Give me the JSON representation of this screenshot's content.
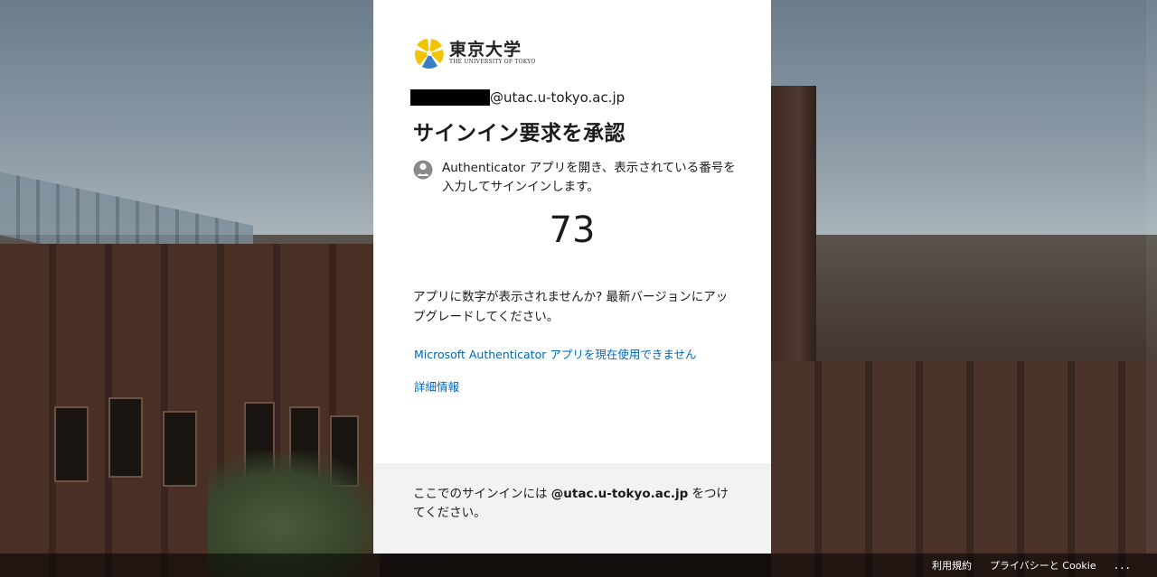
{
  "page": {
    "brand": {
      "name_jp": "東京大学",
      "name_en": "THE UNIVERSITY OF TOKYO",
      "icon": "ginkgo-leaf-icon",
      "colors": {
        "yellow": "#f2c400",
        "blue": "#3a7ec8"
      }
    },
    "account": {
      "email_suffix": "@utac.u-tokyo.ac.jp"
    },
    "title": "サインイン要求を承認",
    "instruction": {
      "icon": "user-lock-icon",
      "text": "Authenticator アプリを開き、表示されている番号を入力してサインインします。"
    },
    "number": "73",
    "upgrade_text": "アプリに数字が表示されませんか? 最新バージョンにアップグレードしてください。",
    "links": {
      "cannot_use": "Microsoft Authenticator アプリを現在使用できません",
      "more_info": "詳細情報"
    },
    "hint": {
      "prefix": "ここでのサインインには ",
      "domain": "@utac.u-tokyo.ac.jp",
      "suffix": " をつけてください。"
    },
    "footer": {
      "terms": "利用規約",
      "privacy": "プライバシーと Cookie",
      "more": "..."
    },
    "colors": {
      "link": "#0067b8",
      "annotation_arrow": "#e8191f"
    }
  }
}
